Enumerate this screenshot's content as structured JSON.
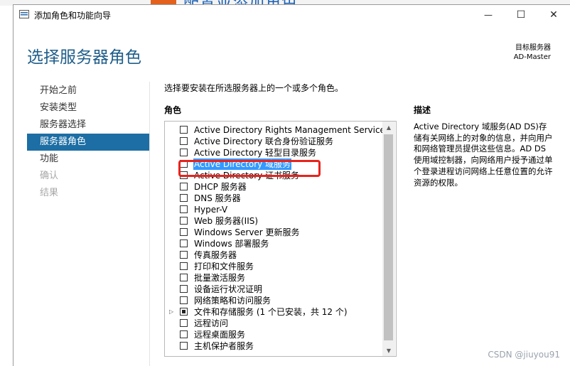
{
  "background_app": {
    "text": "配置並添加角色"
  },
  "window": {
    "title": "添加角色和功能向导",
    "controls": {
      "minimize": "—",
      "maximize": "☐",
      "close": "✕"
    }
  },
  "header": {
    "page_title": "选择服务器角色",
    "target_label": "目标服务器",
    "target_server": "AD-Master"
  },
  "nav": {
    "items": [
      {
        "label": "开始之前",
        "state": "normal"
      },
      {
        "label": "安装类型",
        "state": "normal"
      },
      {
        "label": "服务器选择",
        "state": "normal"
      },
      {
        "label": "服务器角色",
        "state": "active"
      },
      {
        "label": "功能",
        "state": "normal"
      },
      {
        "label": "确认",
        "state": "disabled"
      },
      {
        "label": "结果",
        "state": "disabled"
      }
    ]
  },
  "main": {
    "instruction": "选择要安装在所选服务器上的一个或多个角色。",
    "roles_label": "角色",
    "description_label": "描述",
    "description_text": "Active Directory 域服务(AD DS)存储有关网络上的对象的信息，并向用户和网络管理员提供这些信息。AD DS 使用域控制器，向网络用户授予通过单个登录进程访问网络上任意位置的允许资源的权限。",
    "roles": [
      {
        "label": "Active Directory Rights Management Services",
        "checked": false
      },
      {
        "label": "Active Directory 联合身份验证服务",
        "checked": false
      },
      {
        "label": "Active Directory 轻型目录服务",
        "checked": false
      },
      {
        "label": "Active Directory 域服务",
        "checked": false,
        "selected": true
      },
      {
        "label": "Active Directory 证书服务",
        "checked": false
      },
      {
        "label": "DHCP 服务器",
        "checked": false
      },
      {
        "label": "DNS 服务器",
        "checked": false
      },
      {
        "label": "Hyper-V",
        "checked": false
      },
      {
        "label": "Web 服务器(IIS)",
        "checked": false
      },
      {
        "label": "Windows Server 更新服务",
        "checked": false
      },
      {
        "label": "Windows 部署服务",
        "checked": false
      },
      {
        "label": "传真服务器",
        "checked": false
      },
      {
        "label": "打印和文件服务",
        "checked": false
      },
      {
        "label": "批量激活服务",
        "checked": false
      },
      {
        "label": "设备运行状况证明",
        "checked": false
      },
      {
        "label": "网络策略和访问服务",
        "checked": false
      },
      {
        "label": "文件和存储服务 (1 个已安装，共 12 个)",
        "checked": "partial",
        "expandable": true
      },
      {
        "label": "远程访问",
        "checked": false
      },
      {
        "label": "远程桌面服务",
        "checked": false
      },
      {
        "label": "主机保护者服务",
        "checked": false
      }
    ]
  },
  "watermark": "CSDN @jiuyou91",
  "colors": {
    "accent": "#1c6ea4",
    "title": "#1f5e8a",
    "selection": "#3399ff",
    "annotation": "#e8231c"
  }
}
